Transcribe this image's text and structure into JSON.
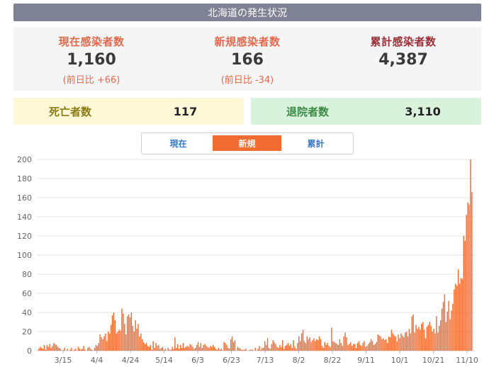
{
  "header": {
    "title": "北海道の発生状況"
  },
  "stats": {
    "current": {
      "label": "現在感染者数",
      "value": "1,160",
      "delta": "(前日比 +66)"
    },
    "new": {
      "label": "新規感染者数",
      "value": "166",
      "delta": "(前日比 -34)"
    },
    "total": {
      "label": "累計感染者数",
      "value": "4,387"
    }
  },
  "death": {
    "label": "死亡者数",
    "value": "117"
  },
  "discharge": {
    "label": "退院者数",
    "value": "3,110"
  },
  "tabs": [
    "現在",
    "新規",
    "累計"
  ],
  "colors": {
    "bar": "#f26b30",
    "tab_active": "#f26b30",
    "title_bg": "#7f8194"
  },
  "chart_data": {
    "type": "bar",
    "x_tick_labels": [
      "3/15",
      "4/4",
      "4/24",
      "5/14",
      "6/3",
      "6/23",
      "7/13",
      "8/2",
      "8/22",
      "9/11",
      "10/1",
      "10/21",
      "11/10"
    ],
    "ylim": [
      0,
      200
    ],
    "y_ticks": [
      0,
      20,
      40,
      60,
      80,
      100,
      120,
      140,
      160,
      180,
      200
    ],
    "grid": true,
    "series": [
      {
        "values": [
          2,
          4,
          3,
          2,
          6,
          1,
          6,
          4,
          7,
          3,
          5,
          8,
          7,
          6,
          4,
          3,
          2,
          0,
          1,
          3,
          0,
          2,
          0,
          1,
          3,
          0,
          1,
          2,
          0,
          4,
          2,
          1,
          2,
          5,
          1,
          0,
          3,
          4,
          2,
          1,
          0,
          3,
          6,
          5,
          8,
          17,
          14,
          12,
          15,
          18,
          10,
          20,
          18,
          27,
          37,
          40,
          32,
          18,
          20,
          22,
          21,
          44,
          39,
          28,
          17,
          36,
          38,
          35,
          40,
          26,
          20,
          32,
          23,
          28,
          15,
          18,
          12,
          9,
          7,
          8,
          5,
          4,
          6,
          1,
          10,
          3,
          8,
          5,
          6,
          2,
          3,
          4,
          1,
          2,
          0,
          3,
          1,
          1,
          4,
          2,
          14,
          3,
          7,
          2,
          6,
          3,
          8,
          3,
          4,
          5,
          4,
          7,
          6,
          4,
          2,
          3,
          6,
          9,
          4,
          8,
          3,
          6,
          7,
          5,
          4,
          3,
          5,
          4,
          6,
          4,
          2,
          1,
          3,
          1,
          2,
          0,
          9,
          8,
          6,
          3,
          2,
          12,
          15,
          9,
          11,
          0,
          4,
          3,
          2,
          1,
          1,
          1,
          2,
          0,
          0,
          1,
          1,
          1,
          0,
          3,
          0,
          2,
          5,
          1,
          3,
          3,
          10,
          6,
          13,
          3,
          2,
          7,
          11,
          9,
          7,
          4,
          3,
          6,
          4,
          11,
          2,
          5,
          6,
          8,
          5,
          7,
          3,
          11,
          4,
          2,
          8,
          15,
          10,
          18,
          22,
          10,
          8,
          15,
          12,
          14,
          9,
          11,
          13,
          10,
          12,
          11,
          15,
          12,
          5,
          3,
          9,
          6,
          8,
          5,
          4,
          24,
          10,
          9,
          8,
          7,
          6,
          12,
          8,
          5,
          15,
          19,
          14,
          6,
          7,
          9,
          5,
          7,
          7,
          3,
          8,
          10,
          6,
          5,
          8,
          10,
          4,
          5,
          7,
          9,
          12,
          10,
          6,
          7,
          9,
          17,
          16,
          15,
          12,
          13,
          11,
          12,
          8,
          15,
          14,
          22,
          18,
          16,
          15,
          10,
          17,
          13,
          18,
          16,
          14,
          19,
          20,
          15,
          23,
          18,
          36,
          38,
          19,
          27,
          23,
          25,
          22,
          28,
          30,
          22,
          13,
          25,
          27,
          30,
          26,
          20,
          23,
          18,
          36,
          19,
          26,
          32,
          44,
          51,
          59,
          30,
          41,
          52,
          33,
          42,
          49,
          64,
          70,
          68,
          85,
          70,
          76,
          75,
          120,
          115,
          142,
          155,
          153,
          200,
          166
        ]
      }
    ]
  }
}
